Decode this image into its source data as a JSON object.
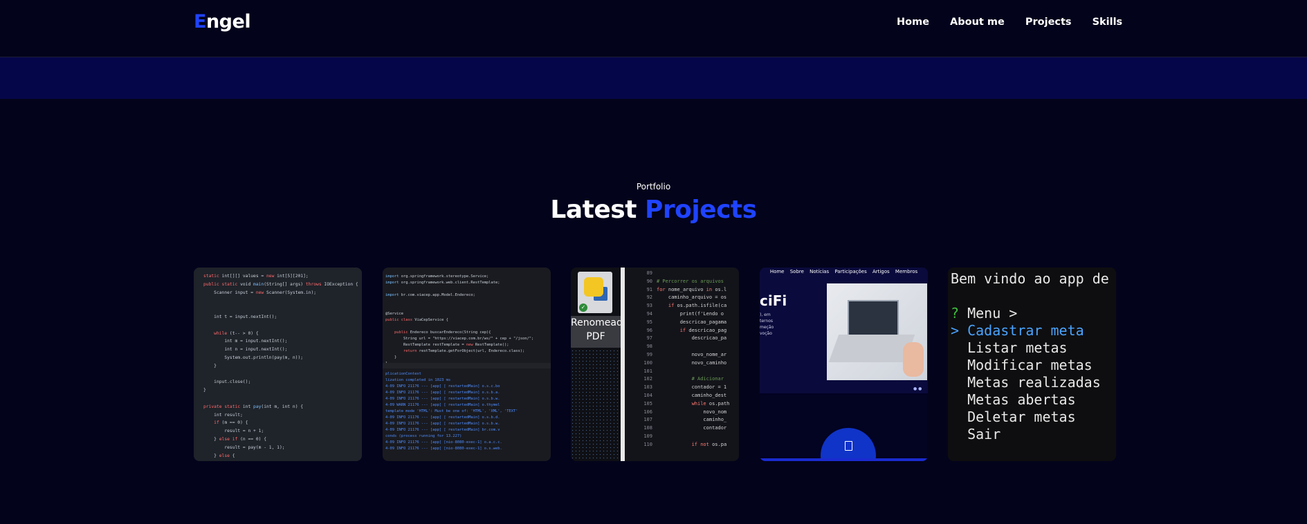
{
  "navbar": {
    "logo_first": "E",
    "logo_rest": "ngel",
    "links": [
      "Home",
      "About me",
      "Projects",
      "Skills"
    ]
  },
  "section": {
    "label": "Portfolio",
    "title_main": "Latest ",
    "title_accent": "Projects"
  },
  "projects": {
    "card3_file_label": "Renomead PDF",
    "card4_nav": [
      "Home",
      "Sobre",
      "Notícias",
      "Participações",
      "Artigos",
      "Membros"
    ],
    "card4_brand": "ciFi",
    "card5_lines": [
      "Bem vindo ao app de",
      "? Menu >",
      "> Cadastrar meta",
      "  Listar metas",
      "  Modificar metas",
      "  Metas realizadas",
      "  Metas abertas",
      "  Deletar metas",
      "  Sair"
    ]
  },
  "colors": {
    "background": "#03031c",
    "accent": "#1f43ff",
    "banner": "#05064a"
  }
}
